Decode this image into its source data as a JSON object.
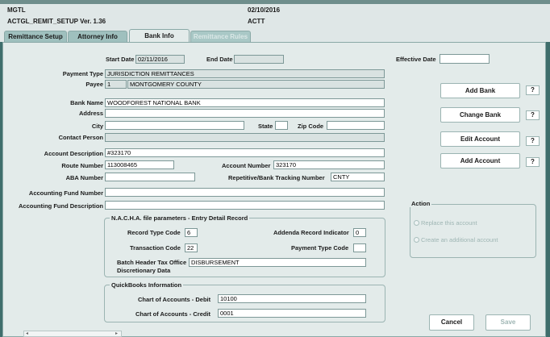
{
  "header": {
    "app_name": "MGTL",
    "date": "02/10/2016",
    "setup_version": "ACTGL_REMIT_SETUP Ver. 1.36",
    "status": "ACTT"
  },
  "tabs": [
    {
      "label": "Remittance Setup"
    },
    {
      "label": "Attorney Info"
    },
    {
      "label": "Bank Info"
    },
    {
      "label": "Remittance Rules"
    }
  ],
  "form": {
    "start_date_label": "Start Date",
    "start_date": "02/11/2016",
    "end_date_label": "End Date",
    "end_date": "",
    "effective_date_label": "Effective Date",
    "effective_date": "",
    "payment_type_label": "Payment Type",
    "payment_type": "JURISDICTION REMITTANCES",
    "payee_label": "Payee",
    "payee_code": "1",
    "payee_name": "MONTGOMERY COUNTY",
    "bank_name_label": "Bank Name",
    "bank_name": "WOODFOREST NATIONAL BANK",
    "address_label": "Address",
    "address": "",
    "city_label": "City",
    "city": "",
    "state_label": "State",
    "state": "",
    "zip_label": "Zip Code",
    "zip": "",
    "contact_label": "Contact Person",
    "contact": "",
    "account_desc_label": "Account Description",
    "account_desc": "#323170",
    "route_label": "Route Number",
    "route": "113008465",
    "account_number_label": "Account Number",
    "account_number": "323170",
    "aba_label": "ABA Number",
    "aba": "",
    "tracking_label": "Repetitive/Bank Tracking Number",
    "tracking": "CNTY",
    "fund_number_label": "Accounting Fund Number",
    "fund_number": "",
    "fund_desc_label": "Accounting Fund Description",
    "fund_desc": ""
  },
  "nacha": {
    "title": "N.A.C.H.A. file parameters - Entry Detail Record",
    "record_type_label": "Record Type Code",
    "record_type": "6",
    "addenda_label": "Addenda Record Indicator",
    "addenda": "0",
    "transaction_label": "Transaction Code",
    "transaction": "22",
    "payment_type_code_label": "Payment Type Code",
    "payment_type_code": "",
    "batch_header_label": "Batch Header Tax Office",
    "discretionary_label": "Discretionary Data",
    "batch_header": "DISBURSEMENT"
  },
  "quickbooks": {
    "title": "QuickBooks Information",
    "debit_label": "Chart of Accounts - Debit",
    "debit": "10100",
    "credit_label": "Chart of Accounts - Credit",
    "credit": "0001"
  },
  "action": {
    "title": "Action",
    "option1": "Replace this account",
    "option2": "Create an additional account"
  },
  "buttons": {
    "add_bank": "Add Bank",
    "change_bank": "Change Bank",
    "edit_account": "Edit Account",
    "add_account": "Add Account",
    "help": "?",
    "cancel": "Cancel",
    "save": "Save"
  }
}
